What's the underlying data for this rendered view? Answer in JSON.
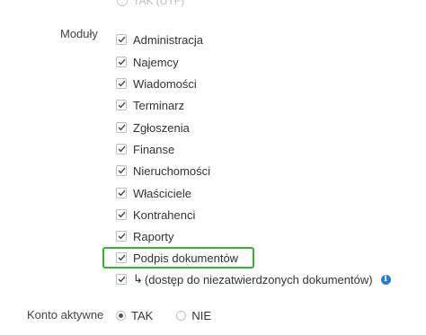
{
  "top_partial": {
    "label": "TAK (UTF)"
  },
  "modules": {
    "label": "Moduły",
    "items": [
      {
        "label": "Administracja",
        "checked": true
      },
      {
        "label": "Najemcy",
        "checked": true
      },
      {
        "label": "Wiadomości",
        "checked": true
      },
      {
        "label": "Terminarz",
        "checked": true
      },
      {
        "label": "Zgłoszenia",
        "checked": true
      },
      {
        "label": "Finanse",
        "checked": true
      },
      {
        "label": "Nieruchomości",
        "checked": true
      },
      {
        "label": "Właściciele",
        "checked": true
      },
      {
        "label": "Kontrahenci",
        "checked": true
      },
      {
        "label": "Raporty",
        "checked": true
      },
      {
        "label": "Podpis dokumentów",
        "checked": true
      },
      {
        "label": "(dostęp do niezatwierdzonych dokumentów)",
        "checked": true,
        "prefix_icon": "return-arrow-icon",
        "info_icon": "info-icon"
      }
    ]
  },
  "account": {
    "label": "Konto aktywne",
    "options": [
      {
        "label": "TAK",
        "selected": true
      },
      {
        "label": "NIE",
        "selected": false
      }
    ]
  },
  "colors": {
    "highlight": "#3cae3c",
    "info": "#2b7cc7"
  }
}
